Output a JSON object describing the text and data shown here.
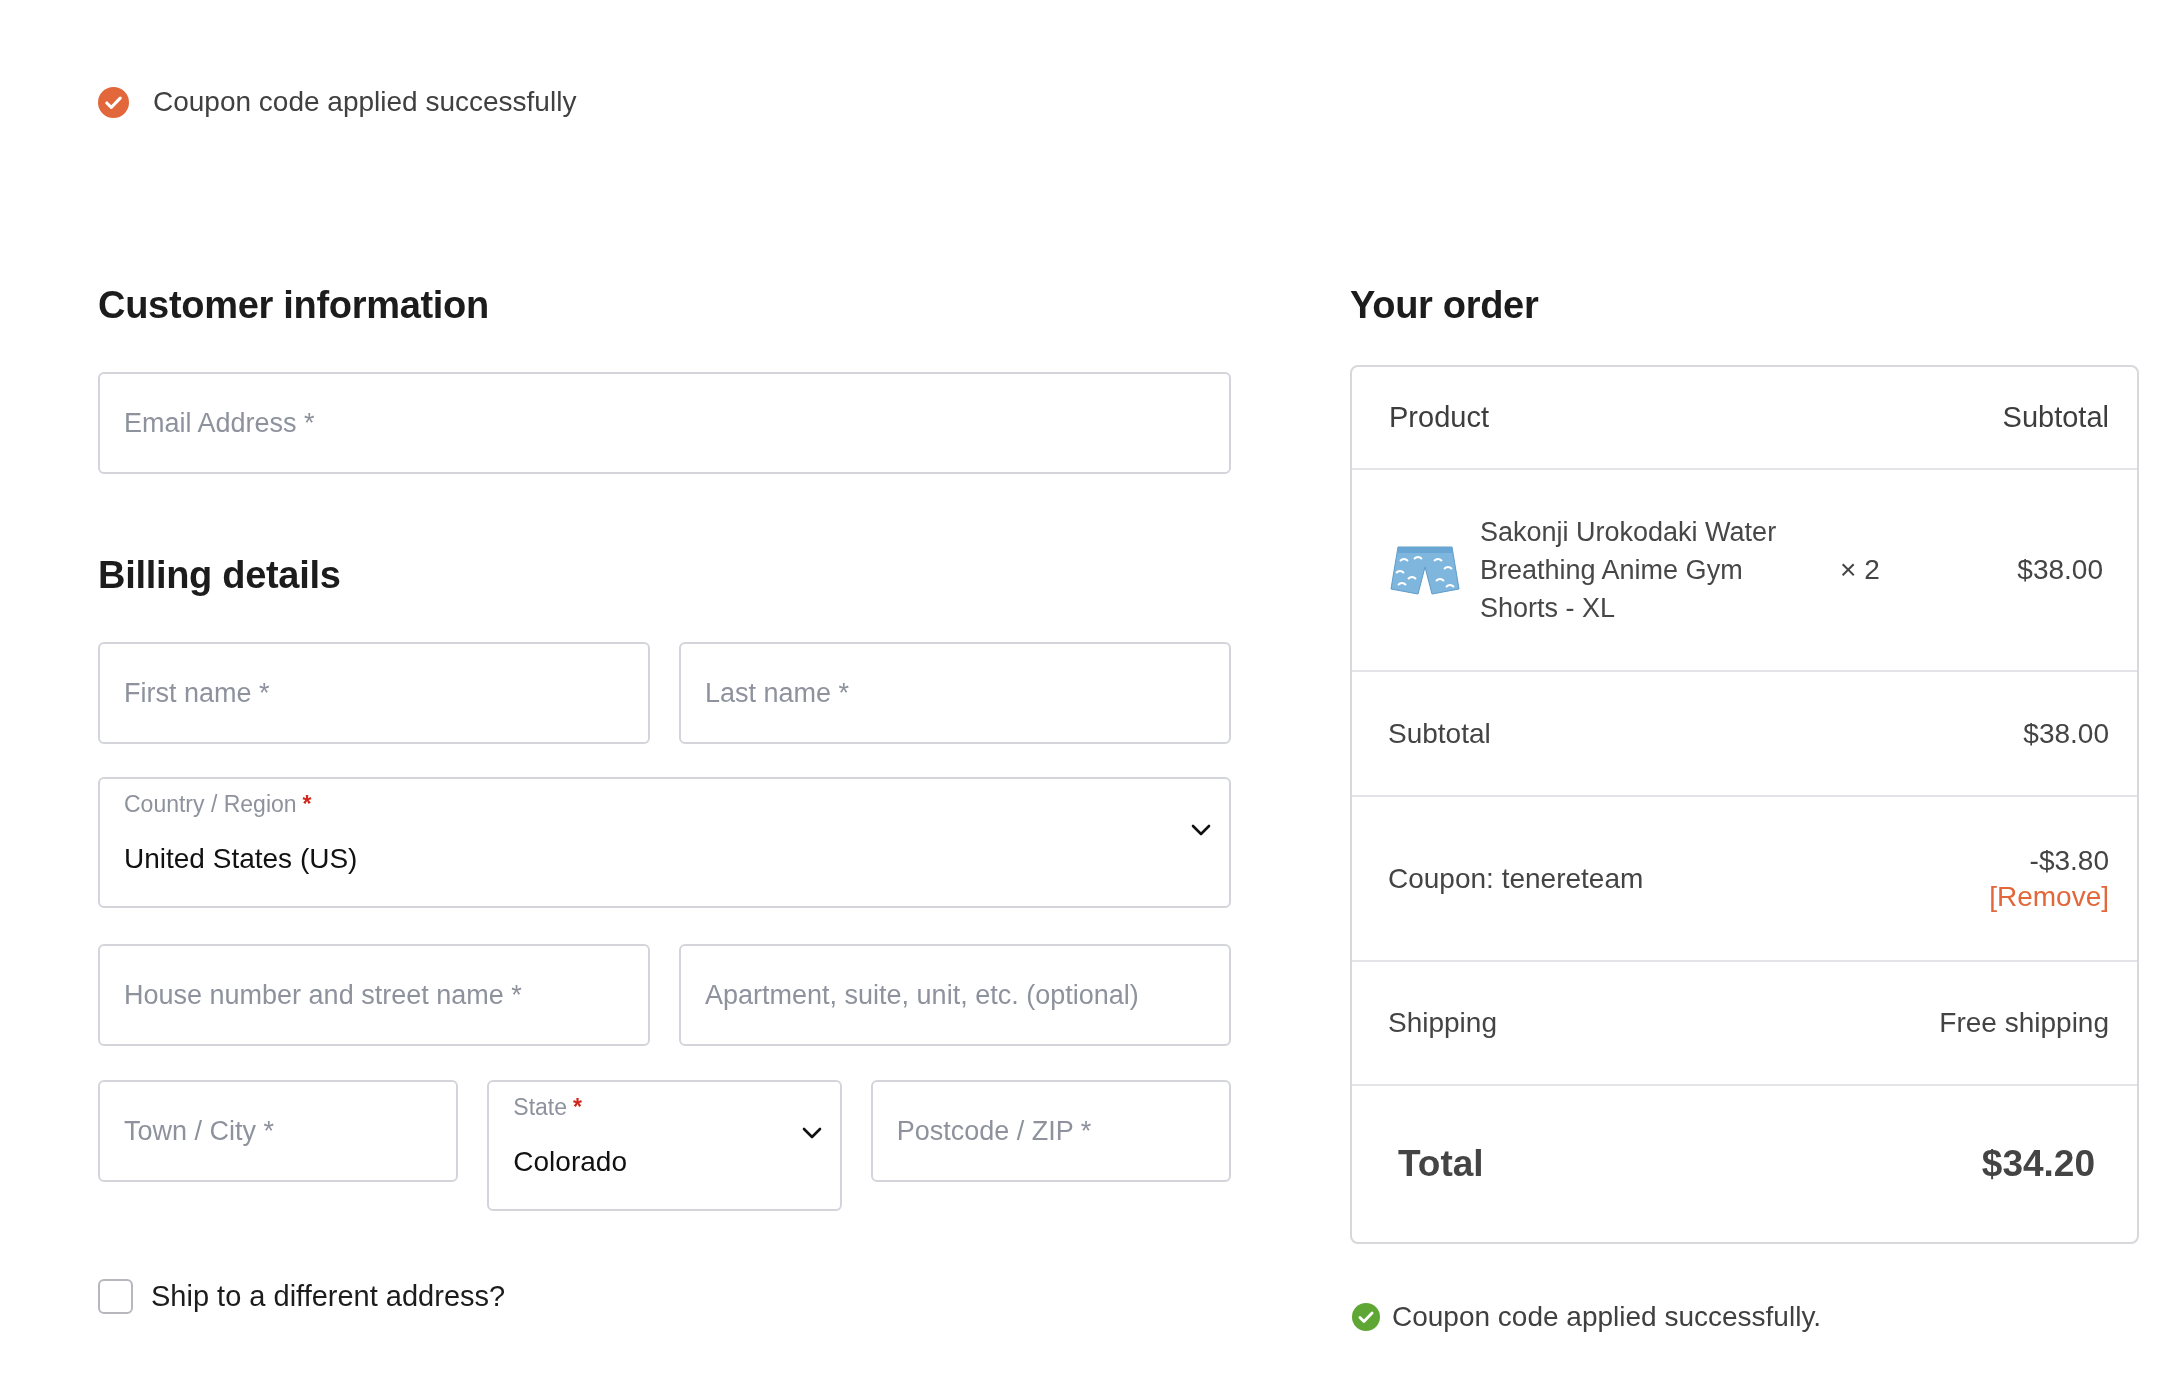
{
  "notice": {
    "text": "Coupon code applied successfully"
  },
  "customer_information": {
    "heading": "Customer information",
    "fields": [
      {
        "kind": "input",
        "placeholder": "Email Address *"
      }
    ]
  },
  "billing_details": {
    "heading": "Billing details",
    "rows": [
      [
        {
          "kind": "input",
          "placeholder": "First name *"
        },
        {
          "kind": "input",
          "placeholder": "Last name *"
        }
      ],
      [
        {
          "kind": "select",
          "label": "Country / Region",
          "required_mark": "*",
          "value": "United States (US)"
        }
      ],
      [
        {
          "kind": "input",
          "placeholder": "House number and street name *"
        },
        {
          "kind": "input",
          "placeholder": "Apartment, suite, unit, etc. (optional)"
        }
      ],
      [
        {
          "kind": "input",
          "placeholder": "Town / City *"
        },
        {
          "kind": "select",
          "label": "State",
          "required_mark": "*",
          "value": "Colorado"
        },
        {
          "kind": "input",
          "placeholder": "Postcode / ZIP *"
        }
      ]
    ]
  },
  "ship_to_different_address": {
    "label": "Ship to a different address?",
    "checked": false
  },
  "order": {
    "heading": "Your order",
    "columns": [
      "Product",
      "Subtotal"
    ],
    "items": [
      {
        "name": "Sakonji Urokodaki Water Breathing Anime Gym Shorts - XL",
        "quantity": "× 2",
        "price": "$38.00"
      }
    ],
    "totals": [
      {
        "kind": "subtotal",
        "label": "Subtotal",
        "value": "$38.00"
      },
      {
        "kind": "coupon",
        "label": "Coupon: tenereteam",
        "value": "-$3.80",
        "action": "[Remove]"
      },
      {
        "kind": "shipping",
        "label": "Shipping",
        "value": "Free shipping"
      },
      {
        "kind": "total",
        "label": "Total",
        "value": "$34.20"
      }
    ]
  },
  "order_notice": {
    "text": "Coupon code applied successfully."
  }
}
